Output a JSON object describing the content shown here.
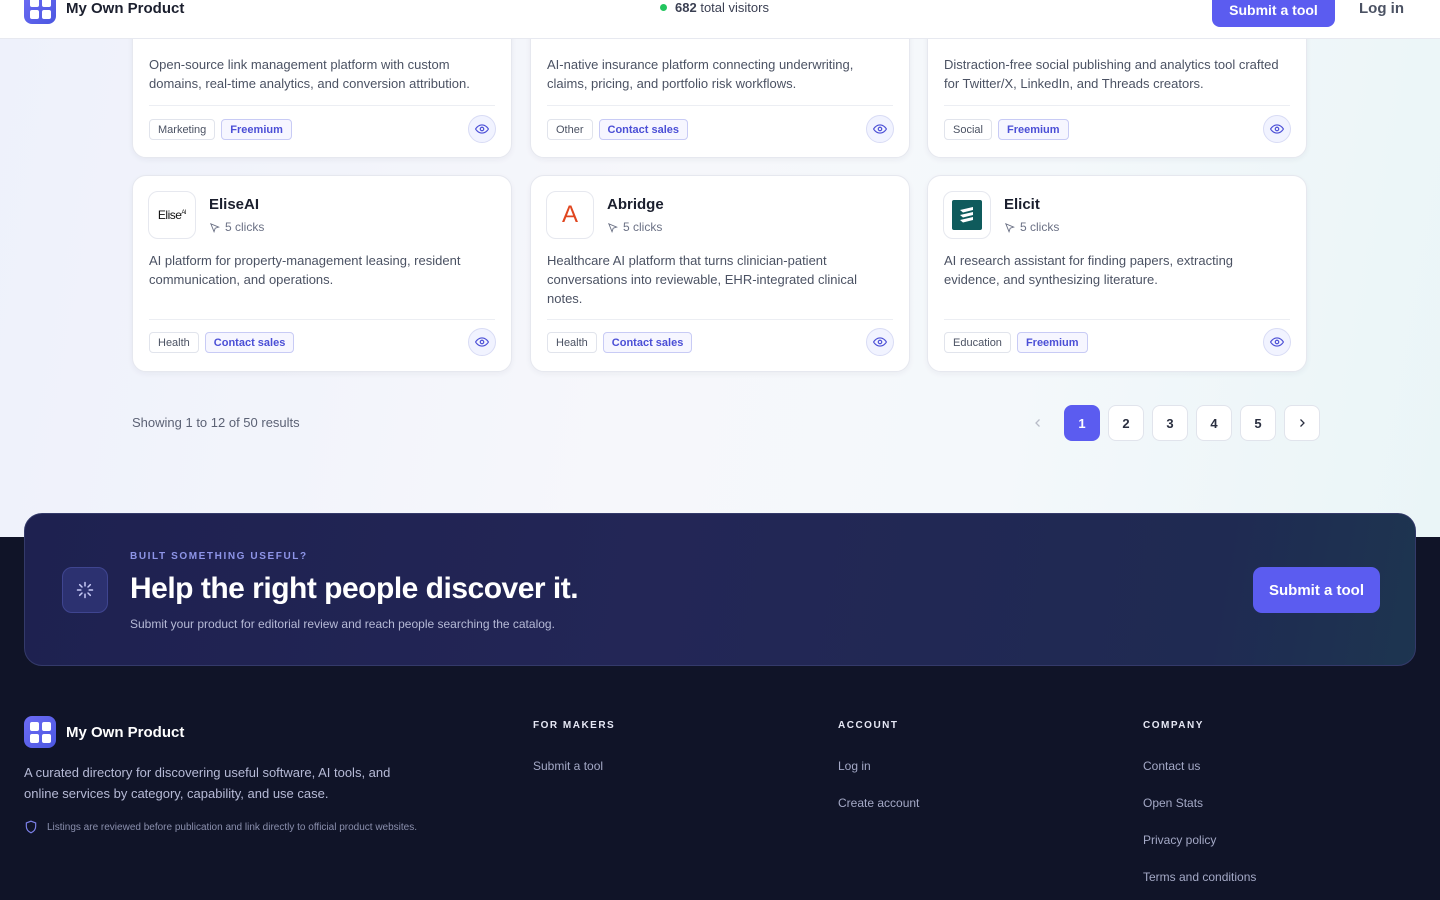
{
  "header": {
    "brand": "My Own Product",
    "visitors_count": "682",
    "visitors_label": "total visitors",
    "submit_label": "Submit a tool",
    "login_label": "Log in"
  },
  "cards_top": [
    {
      "description": "Open-source link management platform with custom domains, real-time analytics, and conversion attribution.",
      "category": "Marketing",
      "pricing": "Freemium"
    },
    {
      "description": "AI-native insurance platform connecting underwriting, claims, pricing, and portfolio risk workflows.",
      "category": "Other",
      "pricing": "Contact sales"
    },
    {
      "description": "Distraction-free social publishing and analytics tool crafted for Twitter/X, LinkedIn, and Threads creators.",
      "category": "Social",
      "pricing": "Freemium"
    }
  ],
  "cards": [
    {
      "name": "EliseAI",
      "logo_text": "Elise",
      "logo_sup": "AI",
      "clicks": "5 clicks",
      "description": "AI platform for property-management leasing, resident communication, and operations.",
      "category": "Health",
      "pricing": "Contact sales"
    },
    {
      "name": "Abridge",
      "logo_text": "A",
      "clicks": "5 clicks",
      "description": "Healthcare AI platform that turns clinician-patient conversations into reviewable, EHR-integrated clinical notes.",
      "category": "Health",
      "pricing": "Contact sales"
    },
    {
      "name": "Elicit",
      "clicks": "5 clicks",
      "description": "AI research assistant for finding papers, extracting evidence, and synthesizing literature.",
      "category": "Education",
      "pricing": "Freemium"
    }
  ],
  "pagination": {
    "summary": "Showing 1 to 12 of 50 results",
    "pages": [
      "1",
      "2",
      "3",
      "4",
      "5"
    ],
    "current": "1"
  },
  "cta": {
    "eyebrow": "BUILT SOMETHING USEFUL?",
    "title": "Help the right people discover it.",
    "subtitle": "Submit your product for editorial review and reach people searching the catalog.",
    "button": "Submit a tool"
  },
  "footer": {
    "brand": "My Own Product",
    "description": "A curated directory for discovering useful software, AI tools, and online services by category, capability, and use case.",
    "note": "Listings are reviewed before publication and link directly to official product websites.",
    "columns": [
      {
        "heading": "FOR MAKERS",
        "links": [
          "Submit a tool"
        ]
      },
      {
        "heading": "ACCOUNT",
        "links": [
          "Log in",
          "Create account"
        ]
      },
      {
        "heading": "COMPANY",
        "links": [
          "Contact us",
          "Open Stats",
          "Privacy policy",
          "Terms and conditions"
        ]
      }
    ]
  },
  "colors": {
    "accent": "#5b5cf0",
    "footer_bg": "#101428",
    "online": "#22c55e"
  },
  "icons": [
    "grid-logo-icon",
    "cursor-click-icon",
    "eye-icon",
    "chevron-left-icon",
    "chevron-right-icon",
    "sparkle-icon",
    "shield-icon"
  ]
}
